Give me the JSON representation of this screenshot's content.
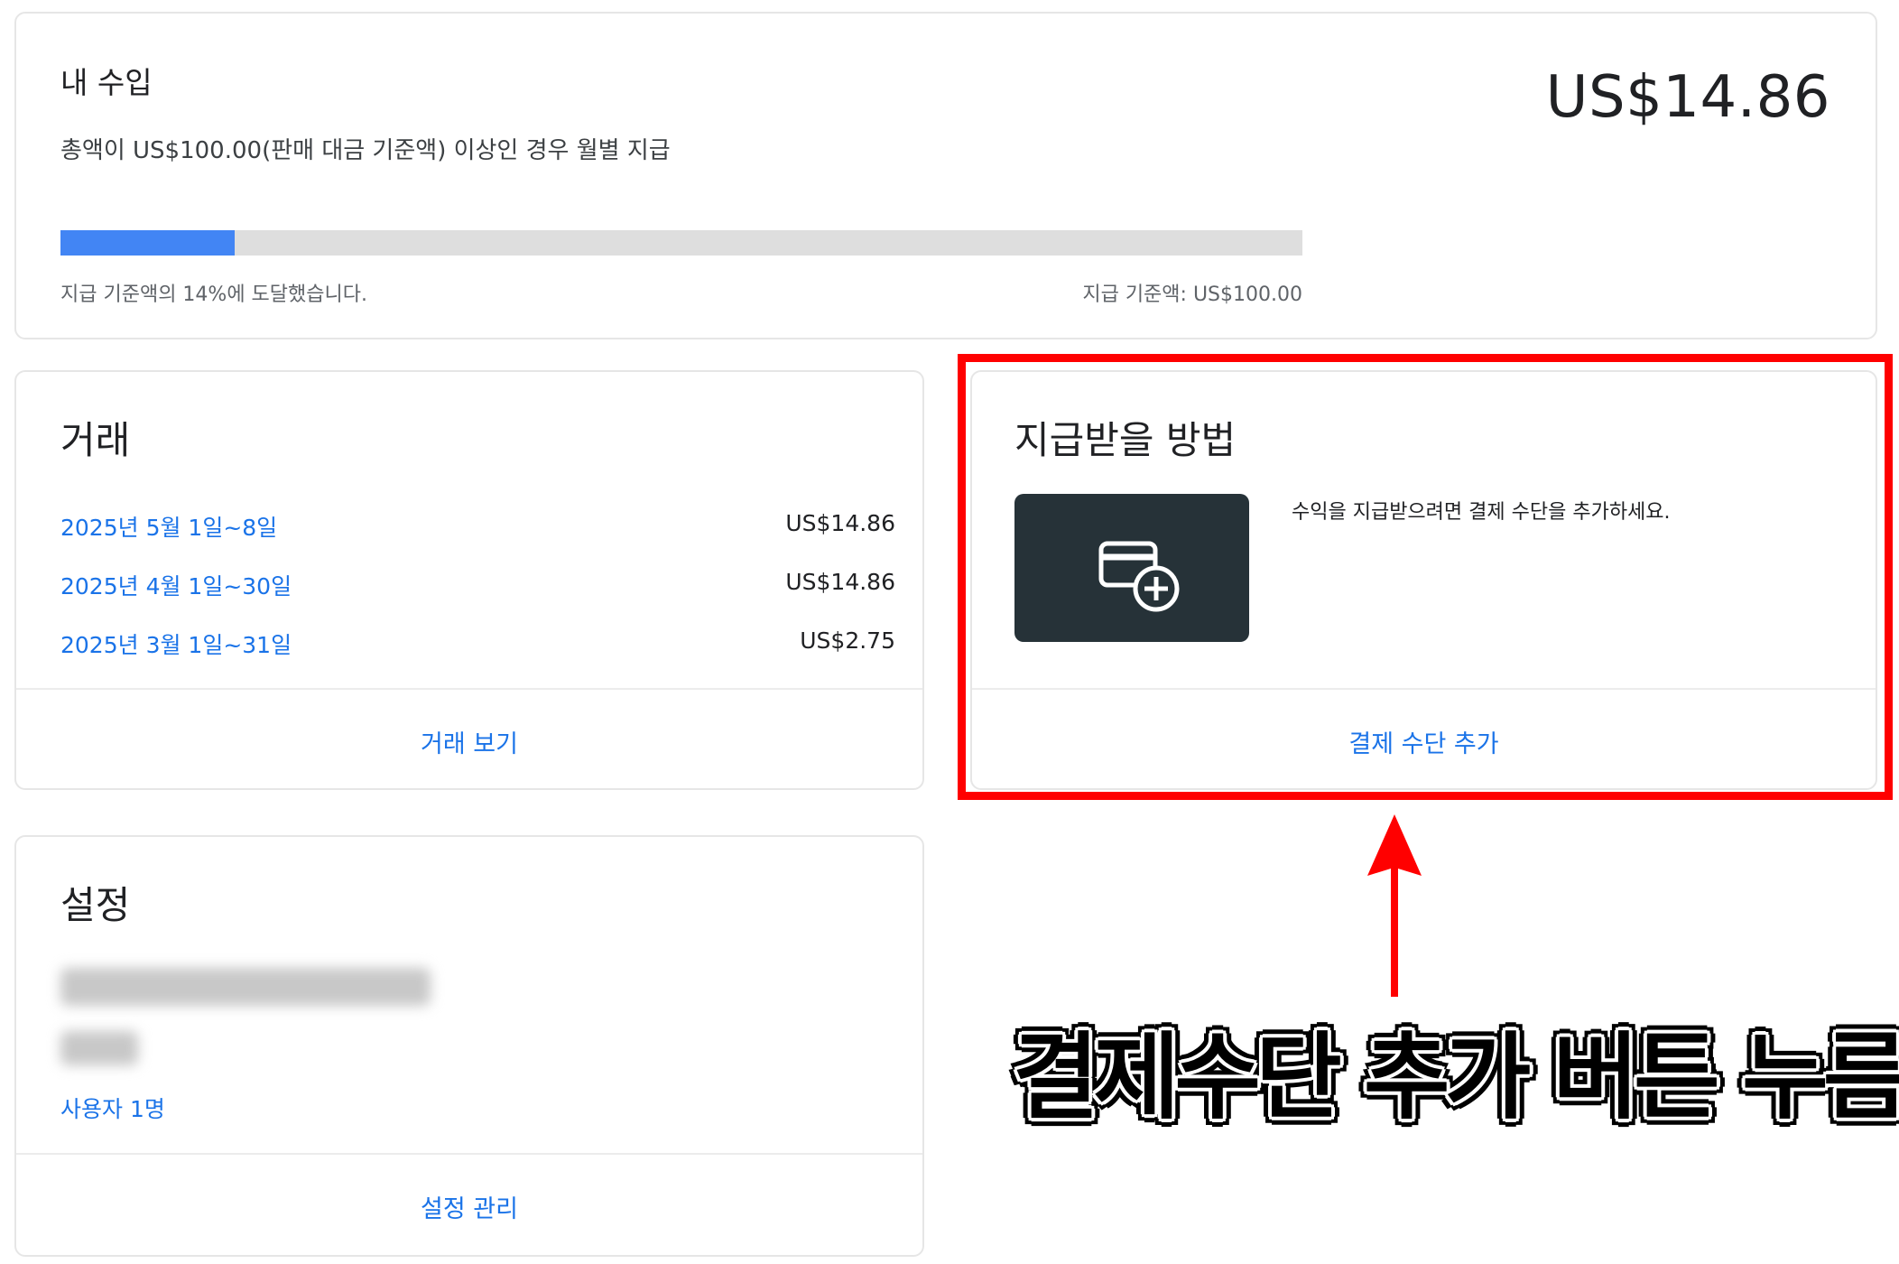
{
  "earnings": {
    "title": "내 수입",
    "description": "총액이 US$100.00(판매 대금 기준액) 이상인 경우 월별 지급",
    "amount": "US$14.86",
    "progress_fraction": 0.14,
    "progress_left_label": "지급 기준액의 14%에 도달했습니다.",
    "progress_right_label": "지급 기준액: US$100.00",
    "progress_color": "#4285f4"
  },
  "transactions": {
    "title": "거래",
    "rows": [
      {
        "label": "2025년 5월 1일~8일",
        "amount": "US$14.86"
      },
      {
        "label": "2025년 4월 1일~30일",
        "amount": "US$14.86"
      },
      {
        "label": "2025년 3월 1일~31일",
        "amount": "US$2.75"
      }
    ],
    "view_link": "거래 보기"
  },
  "payment": {
    "title": "지급받을 방법",
    "icon": "add-card-icon",
    "description": "수익을 지급받으려면 결제 수단을 추가하세요.",
    "add_link": "결제 수단 추가",
    "highlight_color": "#ff0000"
  },
  "settings": {
    "title": "설정",
    "users_link": "사용자 1명",
    "manage_link": "설정 관리"
  },
  "annotation": {
    "caption": "결제수단 추가 버튼 누름",
    "arrow_color": "#ff0000"
  },
  "colors": {
    "link": "#1a73e8",
    "tile": "#263238"
  }
}
